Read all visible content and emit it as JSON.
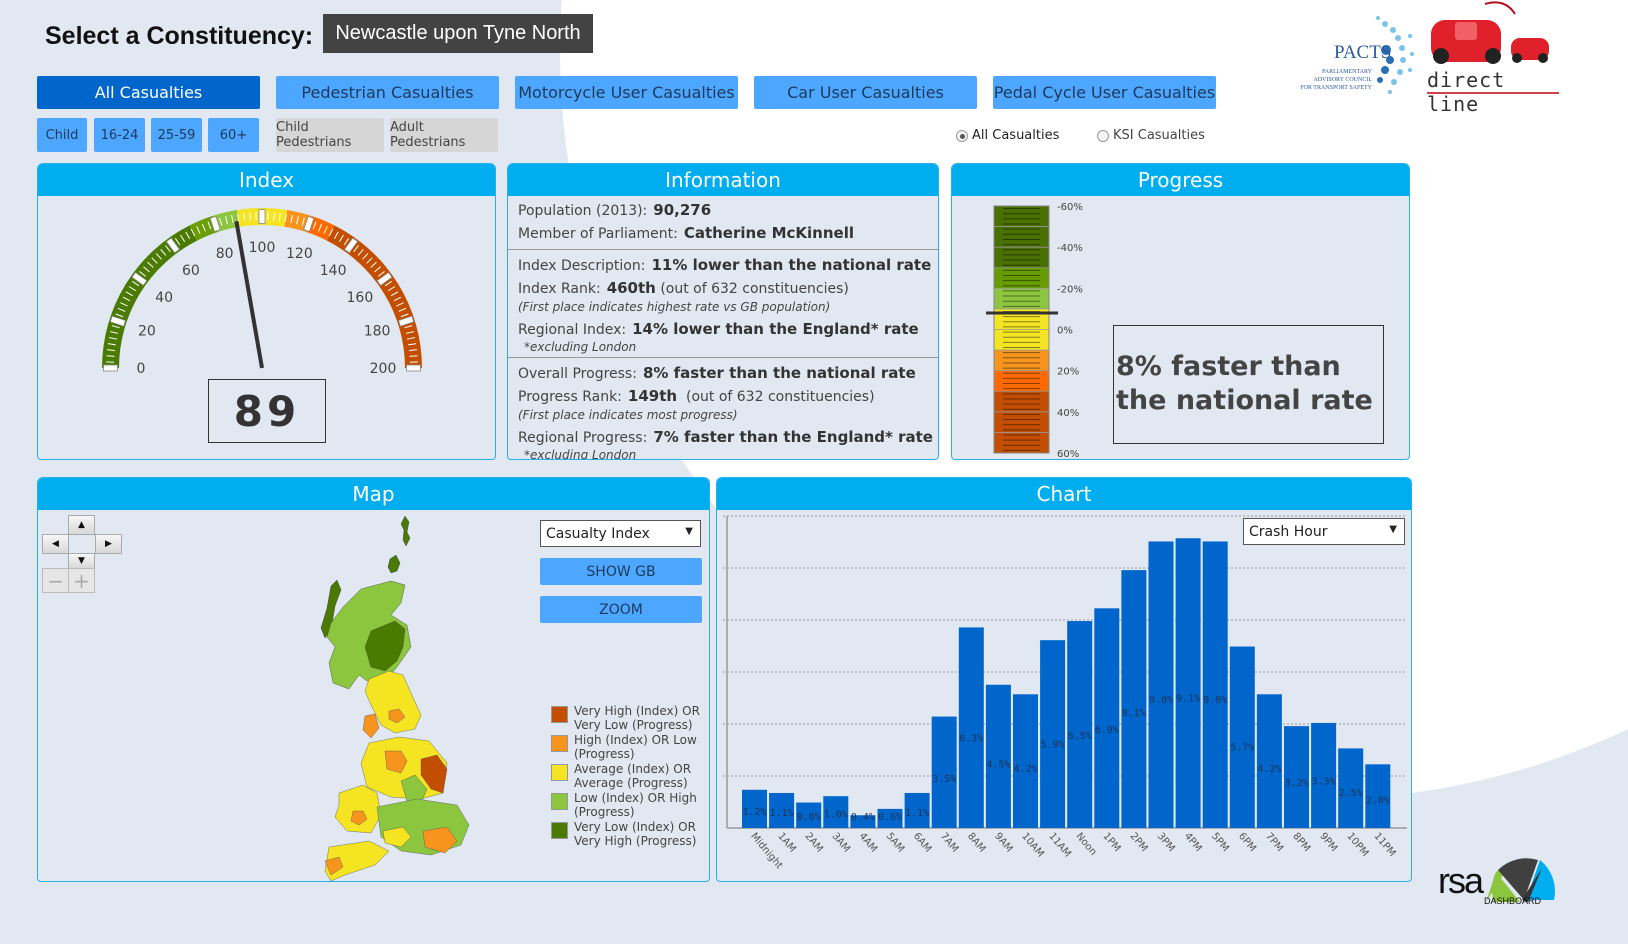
{
  "header": {
    "select_label": "Select a Constituency:",
    "constituency": "Newcastle upon Tyne North"
  },
  "tabs": [
    {
      "label": "All Casualties",
      "active": true
    },
    {
      "label": "Pedestrian Casualties",
      "active": false
    },
    {
      "label": "Motorcycle User Casualties",
      "active": false
    },
    {
      "label": "Car User Casualties",
      "active": false
    },
    {
      "label": "Pedal Cycle User Casualties",
      "active": false
    }
  ],
  "sub_buttons": [
    {
      "label": "Child"
    },
    {
      "label": "16-24"
    },
    {
      "label": "25-59"
    },
    {
      "label": "60+"
    },
    {
      "label": "Child Pedestrians"
    },
    {
      "label": "Adult Pedestrians"
    }
  ],
  "casualty_type": {
    "options": [
      {
        "label": "All Casualties",
        "selected": true
      },
      {
        "label": "KSI Casualties",
        "selected": false
      }
    ]
  },
  "logos": {
    "pacts_title": "PACTS",
    "pacts_sub1": "Parliamentary",
    "pacts_sub2": "Advisory Council",
    "pacts_sub3": "for Transport Safety",
    "direct_line": "direct line",
    "rsa": "rsa",
    "rsa_sub": "DASHBOARD"
  },
  "index_panel": {
    "title": "Index",
    "value": 89,
    "value_label": "89",
    "scale_min": 0,
    "scale_max": 200,
    "tick_labels": [
      "0",
      "20",
      "40",
      "60",
      "80",
      "100",
      "120",
      "140",
      "160",
      "180",
      "200"
    ],
    "bands": [
      {
        "from": 0,
        "to": 70,
        "color": "#4a7a00"
      },
      {
        "from": 70,
        "to": 80,
        "color": "#6a9e00"
      },
      {
        "from": 80,
        "to": 90,
        "color": "#8cc63f"
      },
      {
        "from": 90,
        "to": 110,
        "color": "#f4e422"
      },
      {
        "from": 110,
        "to": 120,
        "color": "#f7941d"
      },
      {
        "from": 120,
        "to": 130,
        "color": "#ff6a00"
      },
      {
        "from": 130,
        "to": 200,
        "color": "#c44e00"
      }
    ]
  },
  "info_panel": {
    "title": "Information",
    "population_label": "Population (2013):",
    "population": "90,276",
    "mp_label": "Member of Parliament:",
    "mp": "Catherine McKinnell",
    "index_desc_label": "Index Description:",
    "index_desc": "11% lower than the national rate",
    "index_rank_label": "Index Rank:",
    "index_rank": "460th",
    "index_rank_suffix": "(out of 632 constituencies)",
    "index_rank_note": "(First place indicates highest rate vs GB population)",
    "regional_index_label": "Regional Index:",
    "regional_index": "14% lower than the England* rate",
    "regional_index_note": "*excluding London",
    "overall_progress_label": "Overall Progress:",
    "overall_progress": "8% faster than the national rate",
    "progress_rank_label": "Progress Rank:",
    "progress_rank": "149th",
    "progress_rank_suffix": "(out of 632 constituencies)",
    "progress_rank_note": "(First place indicates most progress)",
    "regional_progress_label": "Regional Progress:",
    "regional_progress": "7% faster than the England* rate",
    "regional_progress_note": "*excluding London"
  },
  "progress_panel": {
    "title": "Progress",
    "value_pct": -8,
    "scale_min": -60,
    "scale_max": 60,
    "tick_labels": [
      "-60%",
      "-40%",
      "-20%",
      "0%",
      "20%",
      "40%",
      "60%"
    ],
    "bands": [
      {
        "from": -60,
        "to": -30,
        "color": "#4a7000"
      },
      {
        "from": -30,
        "to": -20,
        "color": "#669c00"
      },
      {
        "from": -20,
        "to": -10,
        "color": "#8cc63f"
      },
      {
        "from": -10,
        "to": 10,
        "color": "#f4e422"
      },
      {
        "from": 10,
        "to": 20,
        "color": "#f7941d"
      },
      {
        "from": 20,
        "to": 30,
        "color": "#ff6a00"
      },
      {
        "from": 30,
        "to": 60,
        "color": "#c44e00"
      }
    ],
    "summary": "8% faster than the national rate"
  },
  "map_panel": {
    "title": "Map",
    "nav": {
      "up": "▲",
      "down": "▼",
      "left": "◀",
      "right": "▶",
      "zoom_out": "−",
      "zoom_in": "+"
    },
    "dropdown_value": "Casualty Index",
    "show_gb_label": "SHOW GB",
    "zoom_label": "ZOOM",
    "legend": [
      {
        "label": "Very High (Index) OR Very Low (Progress)",
        "color": "#c44e00"
      },
      {
        "label": "High (Index) OR Low (Progress)",
        "color": "#f7941d"
      },
      {
        "label": "Average (Index) OR Average (Progress)",
        "color": "#f4e422"
      },
      {
        "label": "Low (Index) OR High (Progress)",
        "color": "#8cc63f"
      },
      {
        "label": "Very Low (Index) OR Very High (Progress)",
        "color": "#4a7a00"
      }
    ]
  },
  "chart_panel": {
    "title": "Chart",
    "dropdown_value": "Crash Hour"
  },
  "chart_data": {
    "type": "bar",
    "title": "Chart",
    "xlabel": "",
    "ylabel": "",
    "categories": [
      "Midnight",
      "1AM",
      "2AM",
      "3AM",
      "4AM",
      "5AM",
      "6AM",
      "7AM",
      "8AM",
      "9AM",
      "10AM",
      "11AM",
      "Noon",
      "1PM",
      "2PM",
      "3PM",
      "4PM",
      "5PM",
      "6PM",
      "7PM",
      "8PM",
      "9PM",
      "10PM",
      "11PM"
    ],
    "values": [
      1.2,
      1.1,
      0.8,
      1.0,
      0.4,
      0.6,
      1.1,
      3.5,
      6.3,
      4.5,
      4.2,
      5.9,
      6.5,
      6.9,
      8.1,
      9.0,
      9.1,
      9.0,
      5.7,
      4.2,
      3.2,
      3.3,
      2.5,
      2.0
    ],
    "data_labels": [
      "1.2%",
      "1.1%",
      "0.8%",
      "1.0%",
      "0.4%",
      "0.6%",
      "1.1%",
      "3.5%",
      "6.3%",
      "4.5%",
      "4.2%",
      "5.9%",
      "6.5%",
      "6.9%",
      "8.1%",
      "9.0%",
      "9.1%",
      "9.0%",
      "5.7%",
      "4.2%",
      "3.2%",
      "3.3%",
      "2.5%",
      "2.0%"
    ],
    "units": "%",
    "ylim": [
      0,
      9.8
    ],
    "grid": true,
    "bar_color": "#0066cc"
  }
}
